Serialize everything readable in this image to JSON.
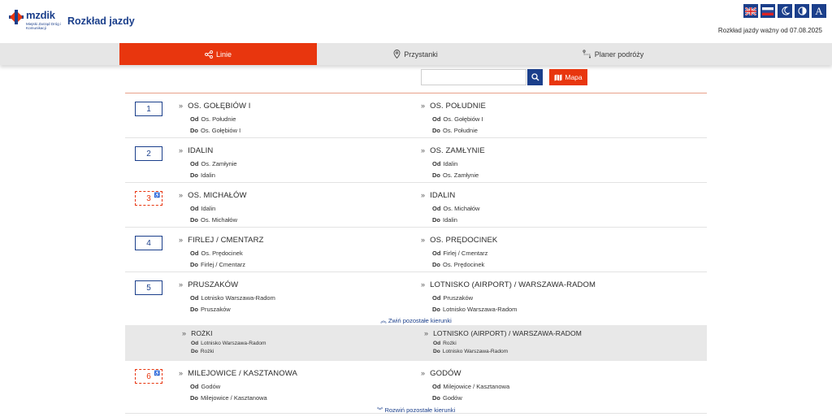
{
  "header": {
    "logo_name": "mzdik",
    "logo_sub": "Miejski Zarząd Dróg i Komunikacji",
    "title": "Rozkład jazdy",
    "validity": "Rozkład jazdy ważny od 07.08.2025",
    "contrast_label": "A"
  },
  "nav": {
    "tabs": [
      {
        "label": "Linie",
        "active": true
      },
      {
        "label": "Przystanki",
        "active": false
      },
      {
        "label": "Planer podróży",
        "active": false
      }
    ]
  },
  "search": {
    "placeholder": "",
    "map_label": "Mapa"
  },
  "labels": {
    "from": "Od",
    "to": "Do"
  },
  "lines": [
    {
      "number": "1",
      "special": false,
      "left": {
        "dest": "OS. GOŁĘBIÓW I",
        "from": "Os. Południe",
        "to": "Os. Gołębiów I"
      },
      "right": {
        "dest": "OS. POŁUDNIE",
        "from": "Os. Gołębiów I",
        "to": "Os. Południe"
      }
    },
    {
      "number": "2",
      "special": false,
      "left": {
        "dest": "IDALIN",
        "from": "Os. Zamłynie",
        "to": "Idalin"
      },
      "right": {
        "dest": "OS. ZAMŁYNIE",
        "from": "Idalin",
        "to": "Os. Zamłynie"
      }
    },
    {
      "number": "3",
      "special": true,
      "left": {
        "dest": "OS. MICHAŁÓW",
        "from": "Idalin",
        "to": "Os. Michałów"
      },
      "right": {
        "dest": "IDALIN",
        "from": "Os. Michałów",
        "to": "Idalin"
      }
    },
    {
      "number": "4",
      "special": false,
      "left": {
        "dest": "FIRLEJ / CMENTARZ",
        "from": "Os. Prędocinek",
        "to": "Firlej / Cmentarz"
      },
      "right": {
        "dest": "OS. PRĘDOCINEK",
        "from": "Firlej / Cmentarz",
        "to": "Os. Prędocinek"
      }
    },
    {
      "number": "5",
      "special": false,
      "left": {
        "dest": "PRUSZAKÓW",
        "from": "Lotnisko Warszawa-Radom",
        "to": "Pruszaków"
      },
      "right": {
        "dest": "LOTNISKO (AIRPORT) / WARSZAWA-RADOM",
        "from": "Pruszaków",
        "to": "Lotnisko Warszawa-Radom"
      }
    },
    {
      "number": "6",
      "special": true,
      "left": {
        "dest": "MILEJOWICE / KASZTANOWA",
        "from": "Godów",
        "to": "Milejowice / Kasztanowa"
      },
      "right": {
        "dest": "GODÓW",
        "from": "Milejowice / Kasztanowa",
        "to": "Godów"
      }
    }
  ],
  "line5_extra": {
    "collapse_label": "Zwiń pozostałe kierunki",
    "left": {
      "dest": "ROŻKI",
      "from": "Lotnisko Warszawa-Radom",
      "to": "Rożki"
    },
    "right": {
      "dest": "LOTNISKO (AIRPORT) / WARSZAWA-RADOM",
      "from": "Rożki",
      "to": "Lotnisko Warszawa-Radom"
    }
  },
  "line6_expand_label": "Rozwiń pozostałe kierunki",
  "colors": {
    "brand_blue": "#1b3f8b",
    "accent_red": "#e8360e"
  },
  "icons": {
    "share": "share-icon",
    "pin": "map-pin-icon",
    "route": "route-icon",
    "search": "search-icon",
    "map": "map-icon"
  }
}
